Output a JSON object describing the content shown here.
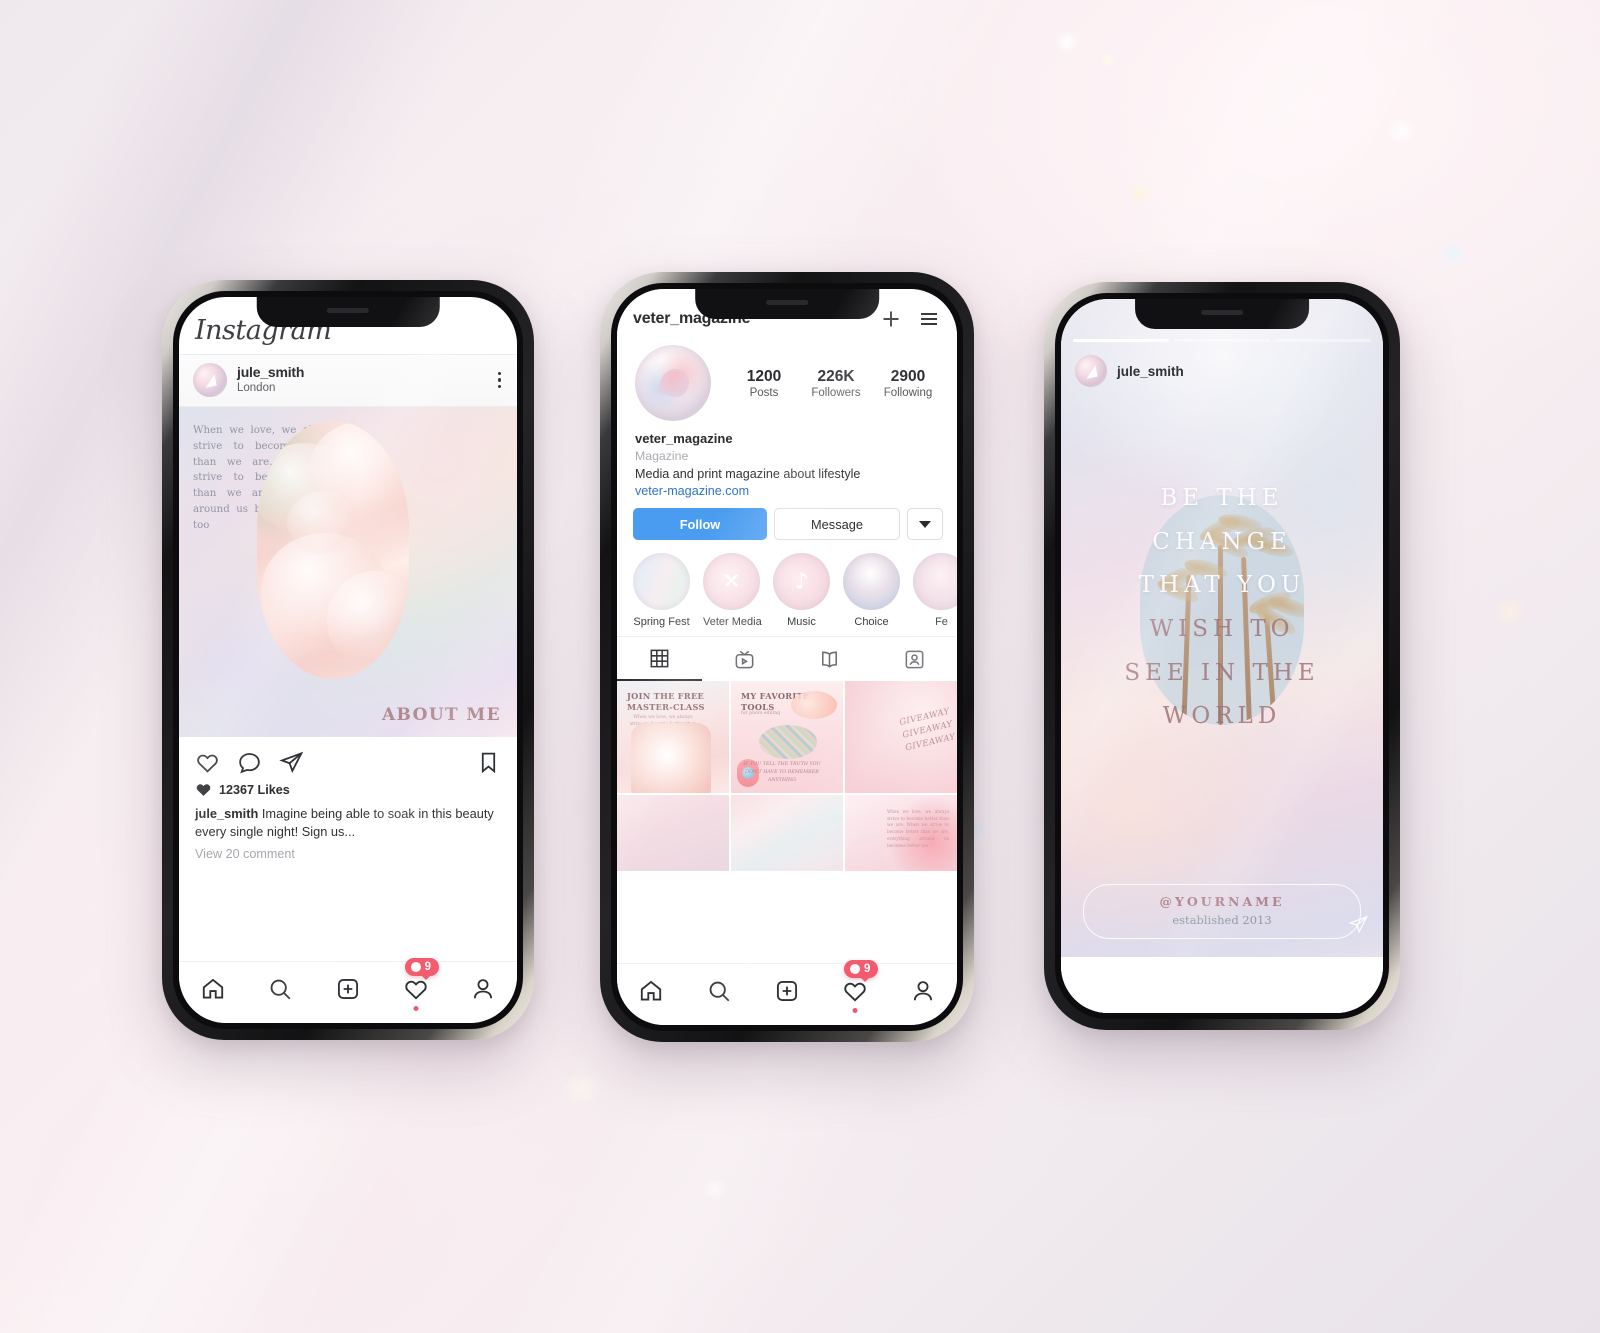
{
  "background": {
    "accent_pink": "#f45b6e",
    "accent_blue": "#4a9cf0",
    "base": "#f2ecef"
  },
  "phone1": {
    "app_logo": "Instagram",
    "post": {
      "username": "jule_smith",
      "location": "London",
      "more_icon": "kebab-menu-icon",
      "quote": "When we love, we always strive to become better than we are. When we strive to become better than we are, everything around us becomes better too",
      "overlay_title": "ABOUT ME",
      "actions": {
        "like": "heart-icon",
        "comment": "comment-icon",
        "share": "paper-plane-icon",
        "save": "bookmark-icon"
      },
      "likes": "12367 Likes",
      "caption_user": "jule_smith",
      "caption_text": " Imagine being able to soak in this beauty every single night! Sign us...",
      "view_comments": "View 20 comment"
    },
    "notification_badge": "9",
    "tabbar": [
      {
        "name": "home",
        "icon": "home-icon"
      },
      {
        "name": "search",
        "icon": "search-icon"
      },
      {
        "name": "create",
        "icon": "plus-square-icon"
      },
      {
        "name": "activity",
        "icon": "heart-icon"
      },
      {
        "name": "profile",
        "icon": "person-icon"
      }
    ]
  },
  "phone2": {
    "header": {
      "title": "veter_magazine",
      "add_icon": "plus-icon",
      "menu_icon": "hamburger-icon"
    },
    "stats": [
      {
        "value": "1200",
        "label": "Posts"
      },
      {
        "value": "226K",
        "label": "Followers"
      },
      {
        "value": "2900",
        "label": "Following"
      }
    ],
    "bio": {
      "name": "veter_magazine",
      "category": "Magazine",
      "description": "Media and print magazine about lifestyle",
      "website": "veter-magazine.com"
    },
    "buttons": {
      "follow": "Follow",
      "message": "Message",
      "more": "chevron-down-icon"
    },
    "highlights": [
      {
        "label": "Spring Fest",
        "mark": ""
      },
      {
        "label": "Veter Media",
        "mark": "✕"
      },
      {
        "label": "Music",
        "mark": "♪"
      },
      {
        "label": "Choice",
        "mark": ""
      },
      {
        "label": "Fe",
        "mark": ""
      }
    ],
    "segments": [
      {
        "name": "grid",
        "icon": "grid-icon",
        "active": true
      },
      {
        "name": "igtv",
        "icon": "tv-icon",
        "active": false
      },
      {
        "name": "guides",
        "icon": "book-icon",
        "active": false
      },
      {
        "name": "tagged",
        "icon": "tagged-person-icon",
        "active": false
      }
    ],
    "grid": [
      {
        "title": "JOIN THE FREE\nMASTER-CLASS",
        "sub": "When we love, we always strive to become better than we are"
      },
      {
        "title": "MY FAVORITE\nTOOLS",
        "sub": "for photo editing",
        "quote": "IF YOU TELL THE TRUTH YOU DON'T HAVE TO REMEMBER ANYTHING"
      },
      {
        "title": "GIVEAWAY\nGIVEAWAY\nGIVEAWAY",
        "sub": ""
      },
      {
        "title": "",
        "sub": ""
      },
      {
        "title": "",
        "sub": ""
      },
      {
        "title": "",
        "sub": "When we love, we always strive to become better than we are. When we strive to become better than we are, everything around us becomes better too"
      }
    ],
    "notification_badge": "9",
    "tabbar": [
      {
        "name": "home",
        "icon": "home-icon"
      },
      {
        "name": "search",
        "icon": "search-icon"
      },
      {
        "name": "create",
        "icon": "plus-square-icon"
      },
      {
        "name": "activity",
        "icon": "heart-icon"
      },
      {
        "name": "profile",
        "icon": "person-icon"
      }
    ]
  },
  "phone3": {
    "progress_segments": 3,
    "username": "jule_smith",
    "quote_lines": [
      "BE THE",
      "CHANGE",
      "THAT YOU",
      "WISH TO",
      "SEE IN THE",
      "WORLD"
    ],
    "footer_handle": "@YOURNAME",
    "footer_established": "established 2013",
    "send_icon": "paper-plane-icon"
  }
}
